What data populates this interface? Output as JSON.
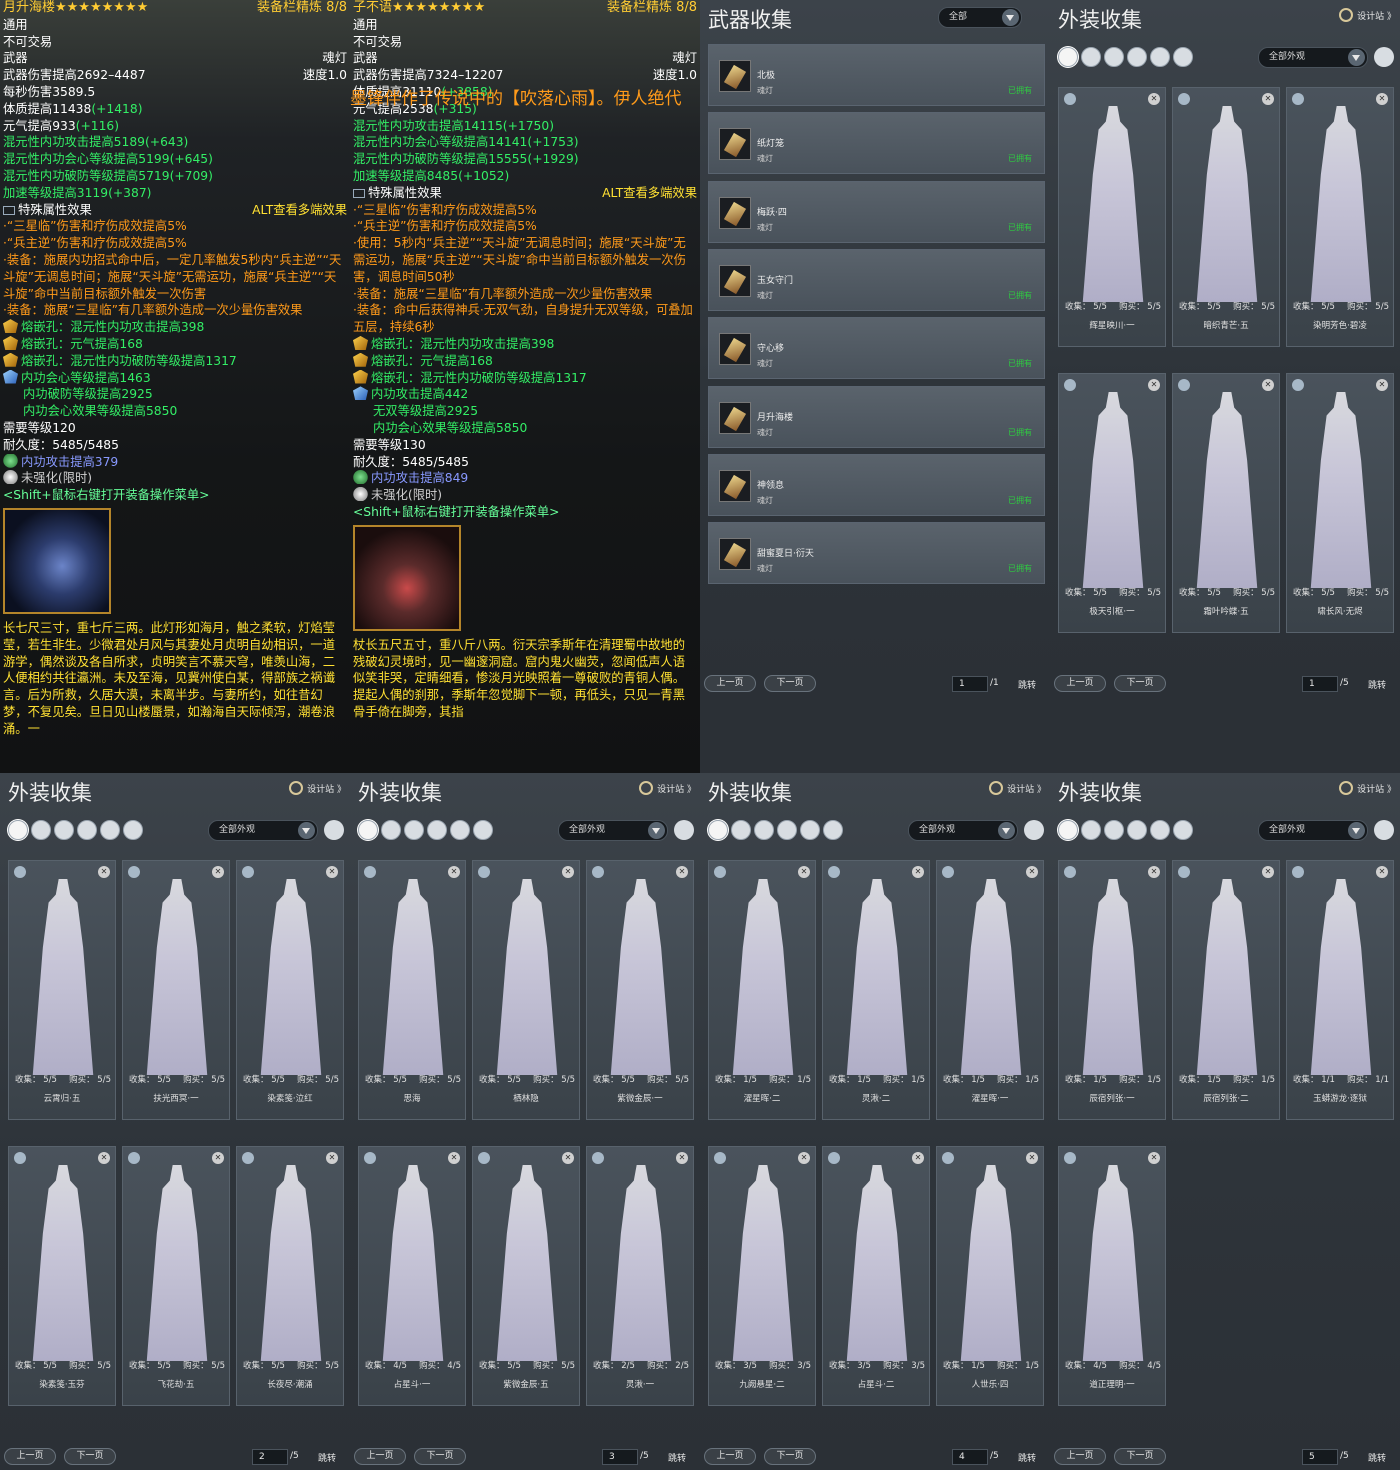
{
  "left_tip": {
    "title": "月升海楼★★★★★★★★",
    "right_title": "装备栏精炼 8/8",
    "lines": [
      {
        "t": "通用",
        "c": "white"
      },
      {
        "t": "不可交易",
        "c": "white"
      },
      {
        "t": "武器",
        "r": "魂灯",
        "c": "white"
      },
      {
        "t": "武器伤害提高2692–4487",
        "r": "速度1.0",
        "c": "white"
      },
      {
        "t": "每秒伤害3589.5",
        "c": "white"
      },
      {
        "t": "体质提高11438",
        "g": "(+1418)",
        "c": "white"
      },
      {
        "t": "元气提高933",
        "g": "(+116)",
        "c": "white"
      },
      {
        "t": "混元性内功攻击提高5189",
        "g": "(+643)",
        "c": "green"
      },
      {
        "t": "混元性内功会心等级提高5199",
        "g": "(+645)",
        "c": "green"
      },
      {
        "t": "混元性内功破防等级提高5719",
        "g": "(+709)",
        "c": "green"
      },
      {
        "t": "加速等级提高3119",
        "g": "(+387)",
        "c": "green"
      }
    ],
    "special_title": "特殊属性效果",
    "alt": "ALT查看多端效果",
    "effects": [
      "·“三星临”伤害和疗伤成效提高5%",
      "·“兵主逆”伤害和疗伤成效提高5%",
      "·装备：施展内功招式命中后，一定几率触发5秒内“兵主逆”“天斗旋”无调息时间；施展“天斗旋”无需运功，施展“兵主逆”“天斗旋”命中当前目标额外触发一次伤害",
      "·装备：施展“三星临”有几率额外造成一次少量伤害效果"
    ],
    "gems": [
      "熔嵌孔：混元性内功攻击提高398",
      "熔嵌孔：元气提高168",
      "熔嵌孔：混元性内功破防等级提高1317"
    ],
    "enchant": [
      "内功会心等级提高1463",
      "内功破防等级提高2925",
      "内功会心效果等级提高5850"
    ],
    "level": "需要等级120",
    "durability": "耐久度：5485/5485",
    "extra": "内功攻击提高379",
    "unstrengthen": "未强化(限时)",
    "shift": "<Shift+鼠标右键打开装备操作菜单>",
    "desc": "长七尺三寸，重七斤三两。此灯形如海月，触之柔软，灯焰莹莹，若生非生。少微君处月风与其妻处月贞明自幼相识，一道游学，偶然谈及各自所求，贞明笑言不慕天穹，唯羡山海，二人便相约共往瀛洲。未及至海，见冀州使白某，得部族之祸谶言。后为所救，久居大漠，未离半步。与妻所约，如往昔幻梦，不复见矣。旦日见山楼蜃景，如瀚海自天际倾泻，潮卷浪涌。一"
  },
  "right_tip": {
    "title": "子不语★★★★★★★★",
    "right_title": "装备栏精炼 8/8",
    "banner": "墨锋伴作了传说中的【吹落心雨】。伊人绝代",
    "lines": [
      {
        "t": "通用",
        "c": "white"
      },
      {
        "t": "不可交易",
        "c": "white"
      },
      {
        "t": "武器",
        "r": "魂灯",
        "c": "white"
      },
      {
        "t": "武器伤害提高7324–12207",
        "r": "速度1.0",
        "c": "white"
      },
      {
        "t": "",
        "c": "white"
      },
      {
        "t": "体质提高31110",
        "g": "(+3858)",
        "c": "white"
      },
      {
        "t": "元气提高2538",
        "g": "(+315)",
        "c": "white"
      },
      {
        "t": "混元性内功攻击提高14115",
        "g": "(+1750)",
        "c": "green"
      },
      {
        "t": "混元性内功会心等级提高14141",
        "g": "(+1753)",
        "c": "green"
      },
      {
        "t": "混元性内功破防等级提高15555",
        "g": "(+1929)",
        "c": "green"
      },
      {
        "t": "加速等级提高8485",
        "g": "(+1052)",
        "c": "green"
      }
    ],
    "special_title": "特殊属性效果",
    "alt": "ALT查看多端效果",
    "effects": [
      "·“三星临”伤害和疗伤成效提高5%",
      "·“兵主逆”伤害和疗伤成效提高5%",
      "·使用：5秒内“兵主逆”“天斗旋”无调息时间；施展“天斗旋”无需运功，施展“兵主逆”“天斗旋”命中当前目标额外触发一次伤害，调息时间50秒",
      "·装备：施展“三星临”有几率额外造成一次少量伤害效果",
      "·装备：命中后获得神兵·无双气劲，自身提升无双等级，可叠加五层，持续6秒"
    ],
    "gems": [
      "熔嵌孔：混元性内功攻击提高398",
      "熔嵌孔：元气提高168",
      "熔嵌孔：混元性内功破防等级提高1317"
    ],
    "enchant": [
      "内功攻击提高442",
      "无双等级提高2925",
      "内功会心效果等级提高5850"
    ],
    "level": "需要等级130",
    "durability": "耐久度：5485/5485",
    "extra": "内功攻击提高849",
    "unstrengthen": "未强化(限时)",
    "shift": "<Shift+鼠标右键打开装备操作菜单>",
    "desc": "杖长五尺五寸，重八斤八两。衍天宗季斯年在清理蜀中故地的残破幻灵境时，见一幽邃洞窟。窟内鬼火幽荧，忽闻低声人语似笑非哭，定睛细看，惨淡月光映照着一尊破败的青铜人偶。提起人偶的刹那，季斯年忽觉脚下一顿，再低头，只见一青黑骨手倚在脚旁，其指"
  },
  "weapon_panel": {
    "title": "武器收集",
    "filter": "全部",
    "items": [
      {
        "name": "北极",
        "type": "魂灯",
        "owned": "已拥有"
      },
      {
        "name": "纸灯笼",
        "type": "魂灯",
        "owned": "已拥有"
      },
      {
        "name": "梅跃·四",
        "type": "魂灯",
        "owned": "已拥有"
      },
      {
        "name": "玉女守门",
        "type": "魂灯",
        "owned": "已拥有"
      },
      {
        "name": "守心移",
        "type": "魂灯",
        "owned": "已拥有"
      },
      {
        "name": "月升海楼",
        "type": "魂灯",
        "owned": "已拥有"
      },
      {
        "name": "神领息",
        "type": "魂灯",
        "owned": "已拥有"
      },
      {
        "name": "甜蜜夏日·衍天",
        "type": "魂灯",
        "owned": "已拥有"
      }
    ],
    "prev": "上一页",
    "next": "下一页",
    "page": "1",
    "total": "/1",
    "jump": "跳转"
  },
  "appearance_common": {
    "title": "外装收集",
    "designer": "设计站 》",
    "filter": "全部外观",
    "prev": "上一页",
    "next": "下一页",
    "jump": "跳转",
    "collect": "收集：",
    "buy": "购买："
  },
  "appearance_pages": [
    {
      "page": "1",
      "total": "/5",
      "cards": [
        {
          "c": "5/5",
          "b": "5/5",
          "n": "辉星映川·一"
        },
        {
          "c": "5/5",
          "b": "5/5",
          "n": "暗织青芒·五"
        },
        {
          "c": "5/5",
          "b": "5/5",
          "n": "染明芳色·碧凌"
        },
        {
          "c": "5/5",
          "b": "5/5",
          "n": "极天引枢·一"
        },
        {
          "c": "5/5",
          "b": "5/5",
          "n": "霜叶吟蝶·五"
        },
        {
          "c": "5/5",
          "b": "5/5",
          "n": "啸长风·无烬"
        }
      ]
    },
    {
      "page": "2",
      "total": "/5",
      "cards": [
        {
          "c": "5/5",
          "b": "5/5",
          "n": "云霄归·五"
        },
        {
          "c": "5/5",
          "b": "5/5",
          "n": "扶光西冥·一"
        },
        {
          "c": "5/5",
          "b": "5/5",
          "n": "染素笺·泣红"
        },
        {
          "c": "5/5",
          "b": "5/5",
          "n": "染素笺·玉芬"
        },
        {
          "c": "5/5",
          "b": "5/5",
          "n": "飞花劫·五"
        },
        {
          "c": "5/5",
          "b": "5/5",
          "n": "长夜尽·潮涌"
        }
      ]
    },
    {
      "page": "3",
      "total": "/5",
      "cards": [
        {
          "c": "5/5",
          "b": "5/5",
          "n": "思海"
        },
        {
          "c": "5/5",
          "b": "5/5",
          "n": "栖林隐"
        },
        {
          "c": "5/5",
          "b": "5/5",
          "n": "紫微金辰·一"
        },
        {
          "c": "4/5",
          "b": "4/5",
          "n": "占星斗·一"
        },
        {
          "c": "5/5",
          "b": "5/5",
          "n": "紫微金辰·五"
        },
        {
          "c": "2/5",
          "b": "2/5",
          "n": "灵湫·一"
        }
      ]
    },
    {
      "page": "4",
      "total": "/5",
      "cards": [
        {
          "c": "1/5",
          "b": "1/5",
          "n": "濯星晖·二"
        },
        {
          "c": "1/5",
          "b": "1/5",
          "n": "灵湫·二"
        },
        {
          "c": "1/5",
          "b": "1/5",
          "n": "濯星晖·一"
        },
        {
          "c": "3/5",
          "b": "3/5",
          "n": "九阙悬星·二"
        },
        {
          "c": "3/5",
          "b": "3/5",
          "n": "占星斗·二"
        },
        {
          "c": "1/5",
          "b": "1/5",
          "n": "人世乐·四"
        }
      ]
    },
    {
      "page": "5",
      "total": "/5",
      "cards": [
        {
          "c": "1/5",
          "b": "1/5",
          "n": "辰宿列张·一"
        },
        {
          "c": "1/5",
          "b": "1/5",
          "n": "辰宿列张·二"
        },
        {
          "c": "1/1",
          "b": "1/1",
          "n": "玉蟒游龙·逐狱"
        },
        {
          "c": "4/5",
          "b": "4/5",
          "n": "道正理明·一"
        }
      ]
    }
  ]
}
